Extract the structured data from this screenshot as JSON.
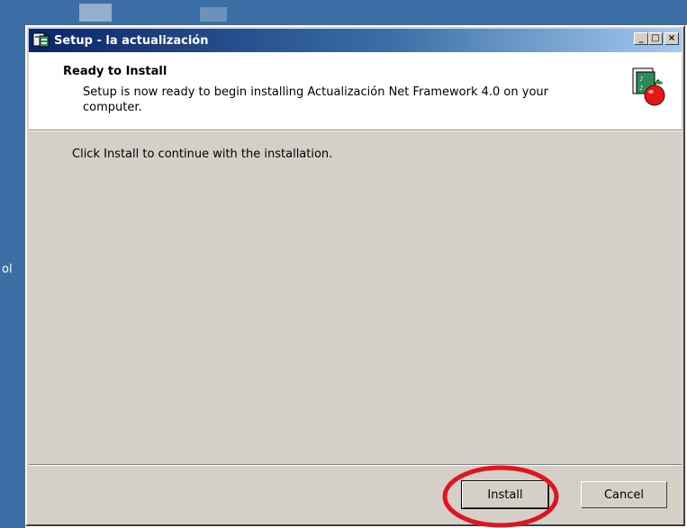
{
  "desktop": {
    "left_fragment": "ol"
  },
  "window": {
    "title": "Setup - la actualización",
    "controls": {
      "minimize": "_",
      "maximize": "□",
      "close": "×"
    }
  },
  "header": {
    "title": "Ready to Install",
    "description": "Setup is now ready to begin installing Actualización Net Framework 4.0 on your computer.",
    "icon": "installer-apple-icon"
  },
  "body": {
    "message": "Click Install to continue with the installation."
  },
  "buttons": {
    "install": "Install",
    "cancel": "Cancel"
  },
  "annotation": {
    "highlight_color": "#e0141e"
  }
}
